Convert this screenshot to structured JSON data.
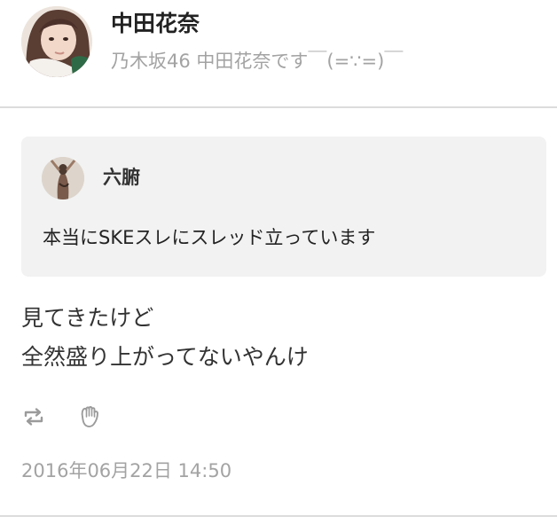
{
  "author": {
    "display_name": "中田花奈",
    "profile_text": "乃木坂46 中田花奈です￣(=∵=)￣"
  },
  "quote": {
    "author_name": "六腑",
    "text": "本当にSKEスレにスレッド立っています"
  },
  "body": {
    "lines": [
      "見てきたけど",
      "全然盛り上がってないやんけ"
    ]
  },
  "actions": {
    "icons": [
      "repost-icon",
      "clap-icon"
    ]
  },
  "timestamp": "2016年06月22日 14:50",
  "colors": {
    "card_background": "#f2f2f2",
    "muted_text": "#a3a3a3",
    "divider": "#dcdcdc",
    "icon": "#9b9b9b"
  }
}
